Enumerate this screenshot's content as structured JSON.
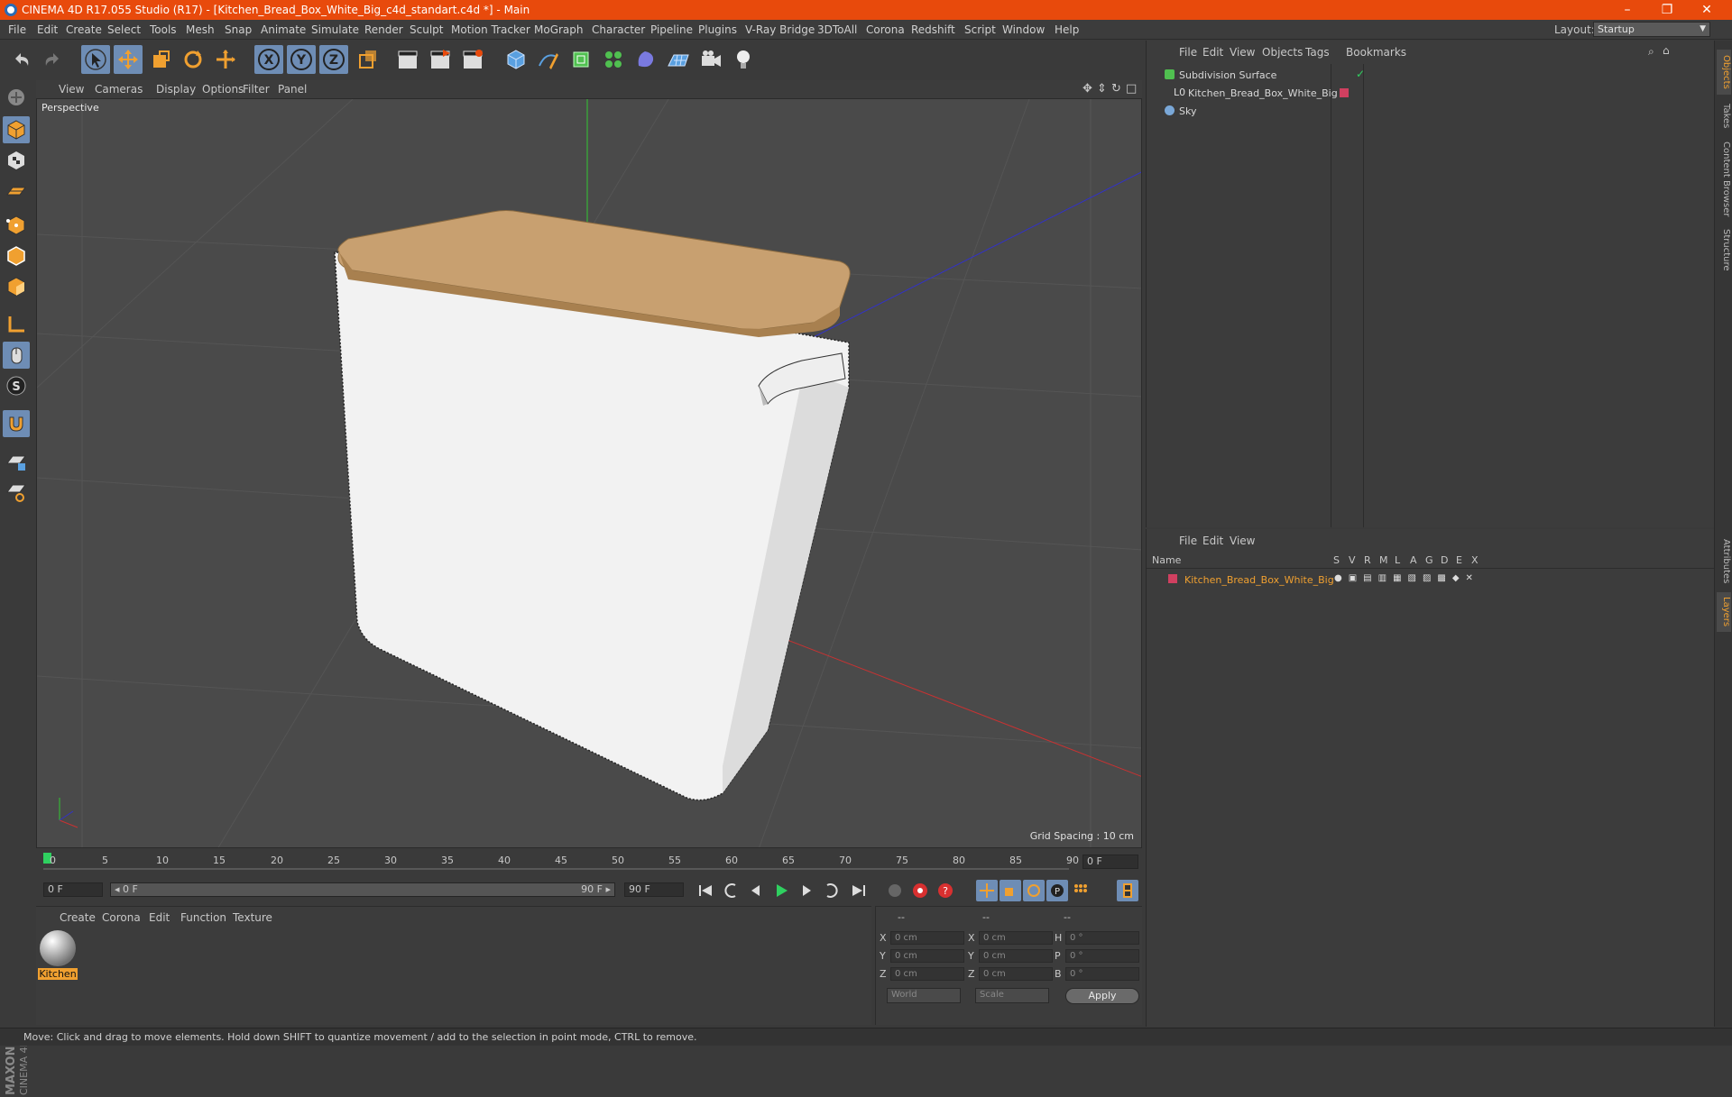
{
  "window": {
    "title": "CINEMA 4D R17.055 Studio (R17) - [Kitchen_Bread_Box_White_Big_c4d_standart.c4d *] - Main",
    "controls": [
      "–",
      "❐",
      "✕"
    ]
  },
  "menubar": {
    "items": [
      "File",
      "Edit",
      "Create",
      "Select",
      "Tools",
      "Mesh",
      "Snap",
      "Animate",
      "Simulate",
      "Render",
      "Sculpt",
      "Motion Tracker",
      "MoGraph",
      "Character",
      "Pipeline",
      "Plugins",
      "V-Ray Bridge",
      "3DToAll",
      "Corona",
      "Redshift",
      "Script",
      "Window",
      "Help"
    ],
    "layout_label": "Layout:",
    "layout_value": "Startup"
  },
  "toolbar": {
    "axis_x": "X",
    "axis_y": "Y",
    "axis_z": "Z"
  },
  "viewport": {
    "menu": [
      "View",
      "Cameras",
      "Display",
      "Options",
      "Filter",
      "Panel"
    ],
    "label": "Perspective",
    "grid_spacing": "Grid Spacing : 10 cm",
    "accent_colors": {
      "x_axis": "#c83232",
      "y_axis": "#32c832",
      "z_axis": "#3232c8",
      "wood": "#c8a070",
      "box": "#f2f2f2"
    }
  },
  "timeline": {
    "ticks": [
      "0",
      "5",
      "10",
      "15",
      "20",
      "25",
      "30",
      "35",
      "40",
      "45",
      "50",
      "55",
      "60",
      "65",
      "70",
      "75",
      "80",
      "85",
      "90"
    ],
    "current_frame": "0 F"
  },
  "playbar": {
    "start_field": "0 F",
    "range_start": "◂ 0 F",
    "range_end": "90 F ▸",
    "end_field": "90 F"
  },
  "materials": {
    "menu": [
      "Create",
      "Corona",
      "Edit",
      "Function",
      "Texture"
    ],
    "items": [
      {
        "name": "Kitchen"
      }
    ]
  },
  "coordinates": {
    "header": [
      "--",
      "--",
      "--"
    ],
    "rows": [
      {
        "axis": "X",
        "pos": "0 cm",
        "size_axis": "X",
        "size": "0 cm",
        "rot_axis": "H",
        "rot": "0 °"
      },
      {
        "axis": "Y",
        "pos": "0 cm",
        "size_axis": "Y",
        "size": "0 cm",
        "rot_axis": "P",
        "rot": "0 °"
      },
      {
        "axis": "Z",
        "pos": "0 cm",
        "size_axis": "Z",
        "size": "0 cm",
        "rot_axis": "B",
        "rot": "0 °"
      }
    ],
    "mode_world": "World",
    "mode_scale": "Scale",
    "apply": "Apply"
  },
  "objects_panel": {
    "menu": [
      "File",
      "Edit",
      "View",
      "Objects",
      "Tags",
      "Bookmarks"
    ],
    "items": [
      {
        "name": "Subdivision Surface"
      },
      {
        "name": "Kitchen_Bread_Box_White_Big"
      },
      {
        "name": "Sky"
      }
    ]
  },
  "layers_panel": {
    "menu": [
      "File",
      "Edit",
      "View"
    ],
    "columns": [
      "Name",
      "S",
      "V",
      "R",
      "M",
      "L",
      "A",
      "G",
      "D",
      "E",
      "X"
    ],
    "items": [
      {
        "name": "Kitchen_Bread_Box_White_Big",
        "color": "#d04060"
      }
    ]
  },
  "right_tabs": [
    "Objects",
    "Takes",
    "Content Browser",
    "Structure",
    "Attributes",
    "Layers"
  ],
  "status": "Move: Click and drag to move elements. Hold down SHIFT to quantize movement / add to the selection in point mode, CTRL to remove."
}
